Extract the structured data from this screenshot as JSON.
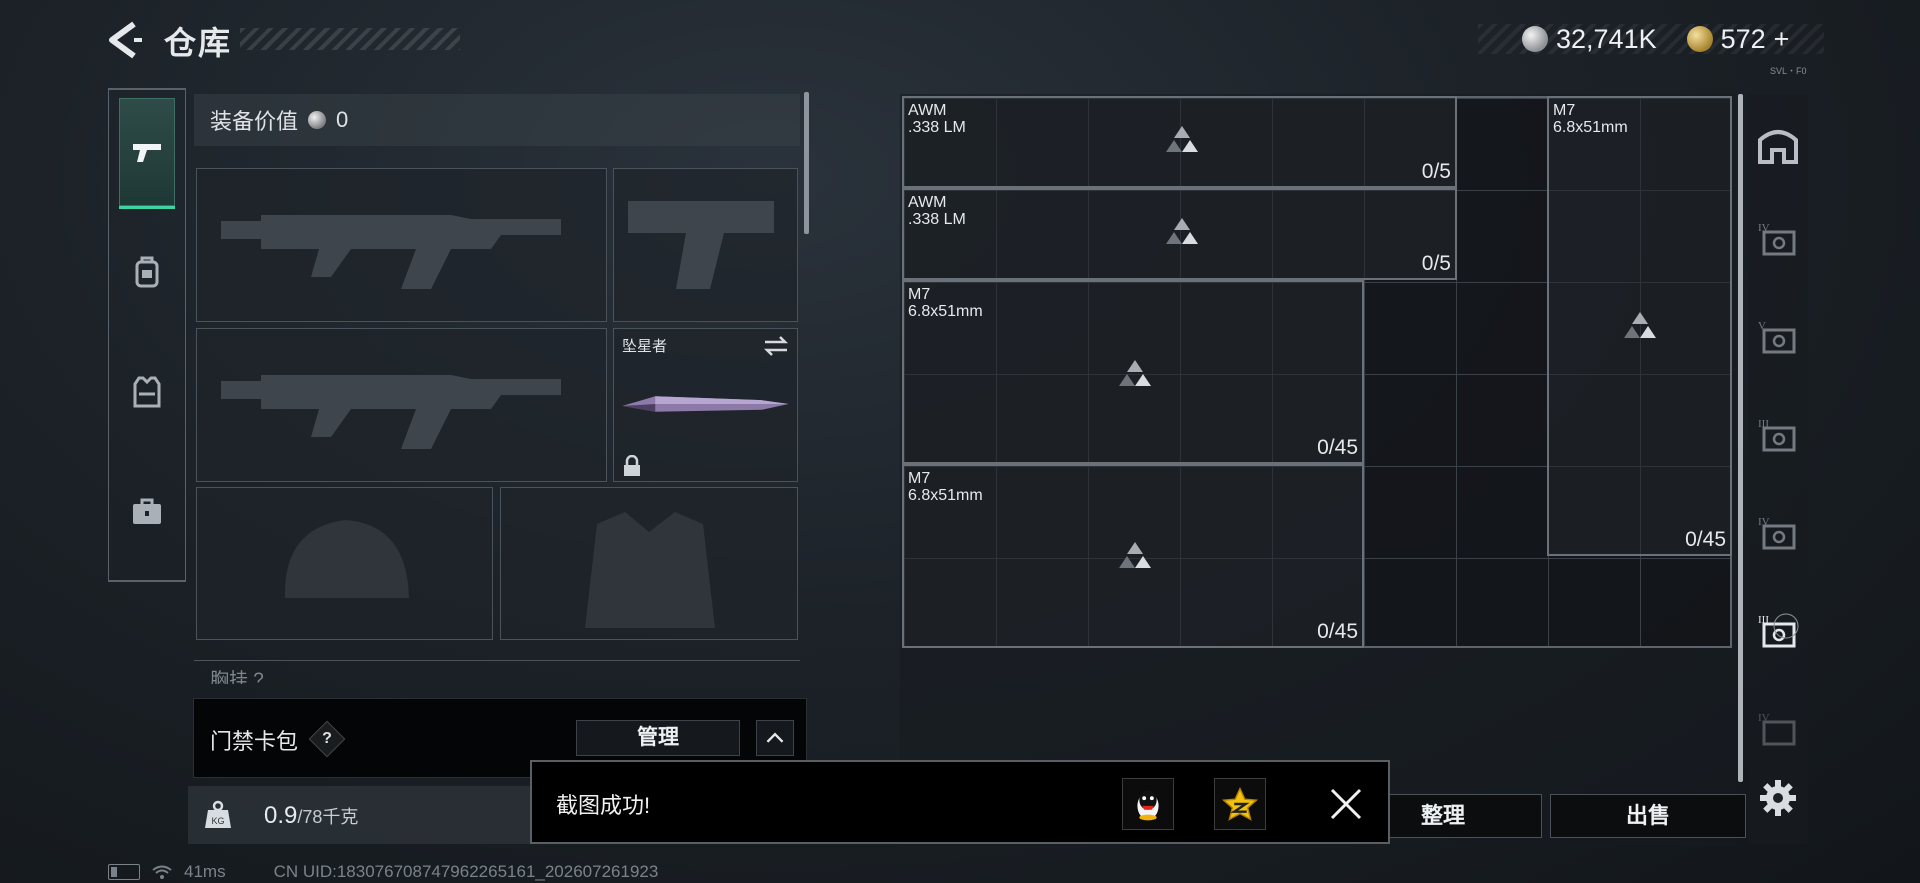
{
  "header": {
    "title": "仓库",
    "currency_silver": "32,741K",
    "currency_gold": "572",
    "gold_plus": "+",
    "small_tag": "SVL・F0"
  },
  "loadout": {
    "value_label": "装备价值",
    "value": "0",
    "melee_name": "坠星者",
    "chest_label": "胸挂 ?"
  },
  "card_pack": {
    "label": "门禁卡包",
    "help": "?",
    "manage": "管理"
  },
  "weight": {
    "current": "0.9",
    "max": "/78千克"
  },
  "status": {
    "ping": "41ms",
    "uid": "CN UID:18307670874796226516​1_202607261923"
  },
  "storage": {
    "items": [
      {
        "name": "AWM\n.338 LM",
        "count": "0/5"
      },
      {
        "name": "AWM\n.338 LM",
        "count": "0/5"
      },
      {
        "name": "M7\n6.8x51mm",
        "count": "0/45"
      },
      {
        "name": "M7\n6.8x51mm",
        "count": "0/45"
      },
      {
        "name": "M7\n6.8x51mm",
        "count": "0/45"
      }
    ],
    "sort": "整理",
    "sell": "出售"
  },
  "toast": {
    "message": "截图成功!"
  },
  "icons": {
    "back": "back-arrow-icon",
    "accent": "#3ed3a3"
  }
}
